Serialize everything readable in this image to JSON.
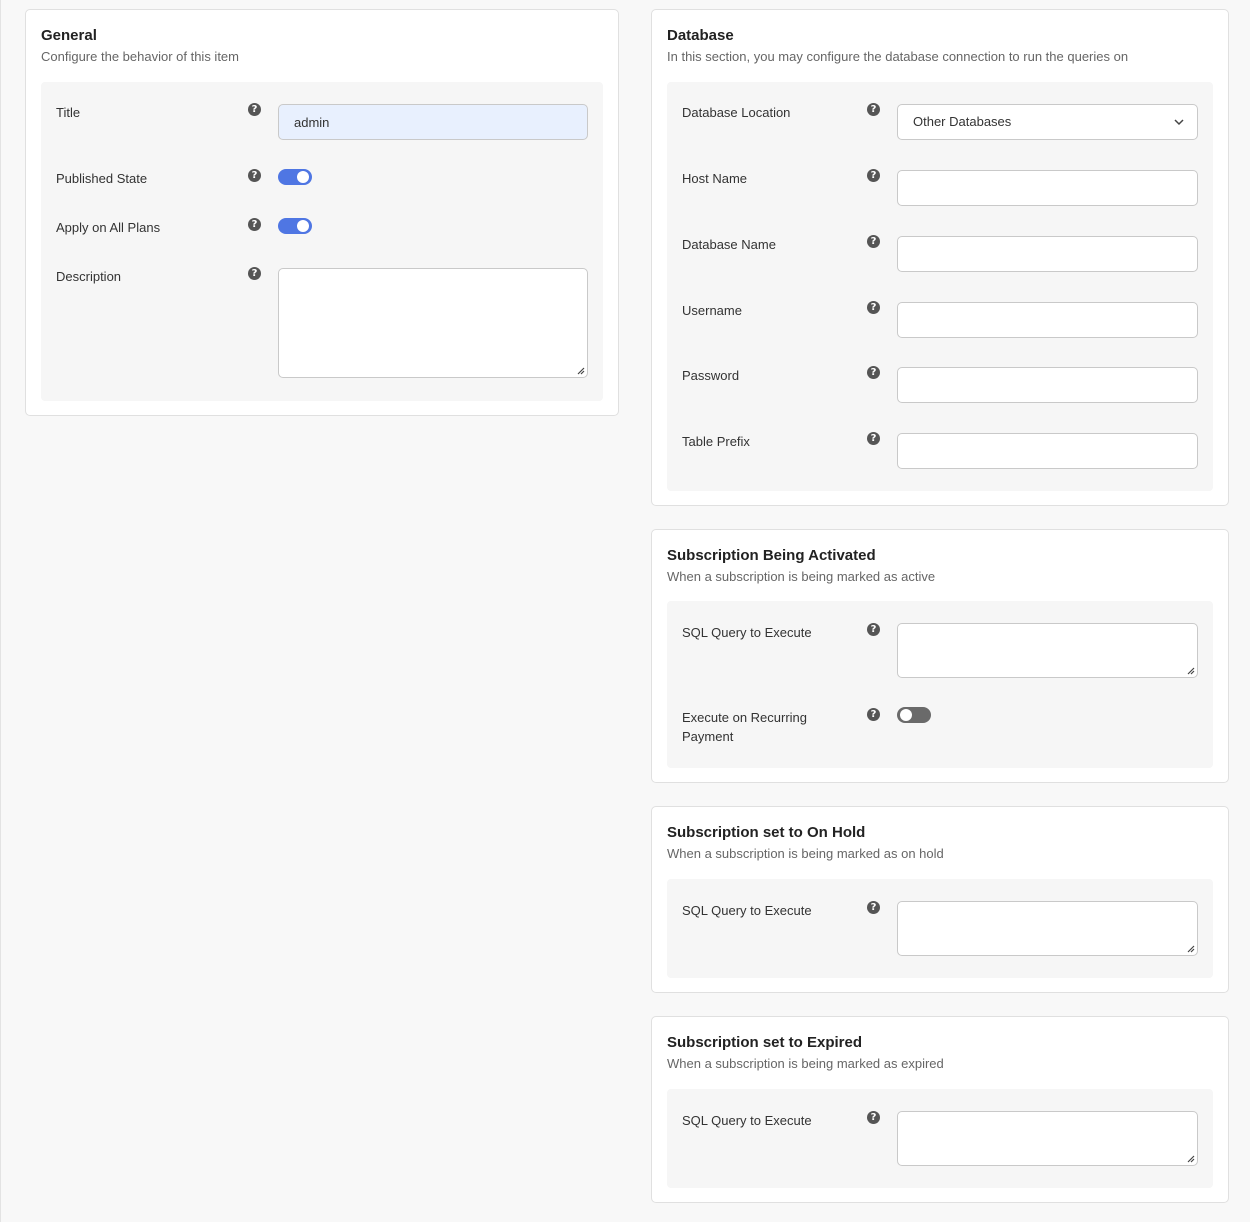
{
  "general": {
    "title": "General",
    "subtitle": "Configure the behavior of this item",
    "fields": {
      "title_label": "Title",
      "title_value": "admin",
      "published_label": "Published State",
      "published_on": true,
      "apply_label": "Apply on All Plans",
      "apply_on": true,
      "description_label": "Description",
      "description_value": ""
    }
  },
  "database": {
    "title": "Database",
    "subtitle": "In this section, you may configure the database connection to run the queries on",
    "location_label": "Database Location",
    "location_value": "Other Databases",
    "host_label": "Host Name",
    "dbname_label": "Database Name",
    "username_label": "Username",
    "password_label": "Password",
    "prefix_label": "Table Prefix"
  },
  "activated": {
    "title": "Subscription Being Activated",
    "subtitle": "When a subscription is being marked as active",
    "sql_label": "SQL Query to Execute",
    "recurring_label": "Execute on Recurring Payment",
    "recurring_on": false
  },
  "onhold": {
    "title": "Subscription set to On Hold",
    "subtitle": "When a subscription is being marked as on hold",
    "sql_label": "SQL Query to Execute"
  },
  "expired": {
    "title": "Subscription set to Expired",
    "subtitle": "When a subscription is being marked as expired",
    "sql_label": "SQL Query to Execute"
  },
  "icons": {
    "help": "help-icon",
    "chevron": "chevron-down-icon",
    "resize": "resize-grip-icon"
  },
  "colors": {
    "toggle_on": "#4f76e3",
    "toggle_off": "#6a6a6a",
    "filled_input": "#e8f0fe"
  }
}
